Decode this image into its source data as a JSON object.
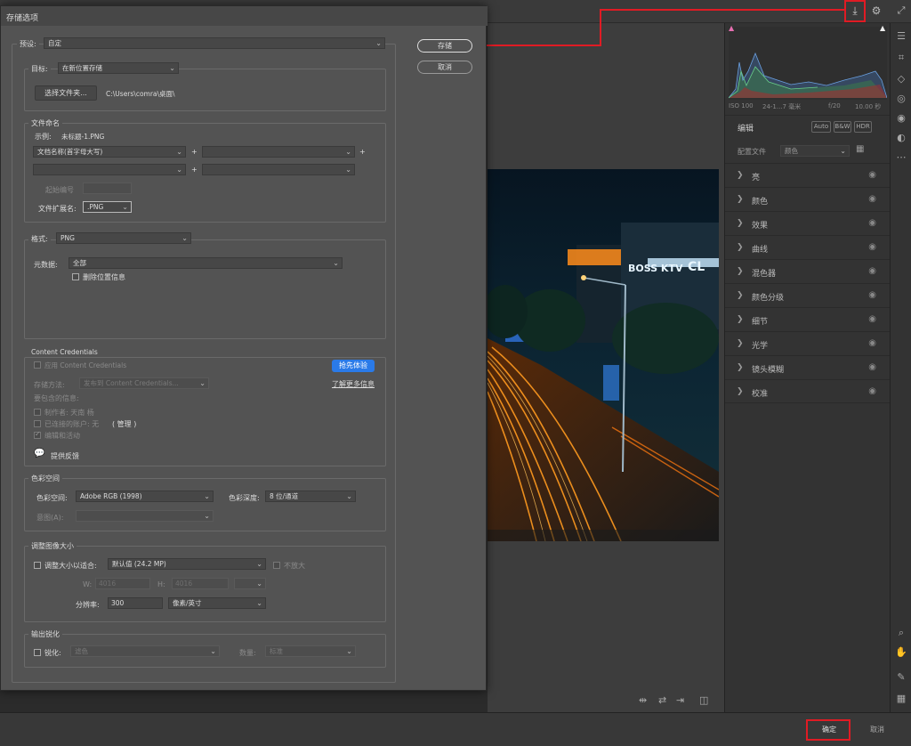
{
  "dialog": {
    "title": "存储选项",
    "preset_label": "预设:",
    "preset_value": "自定",
    "save_button": "存储",
    "cancel_button": "取消",
    "destination": {
      "label": "目标:",
      "value": "在新位置存储",
      "choose_folder_button": "选择文件夹...",
      "path": "C:\\Users\\comra\\桌面\\"
    },
    "file_naming": {
      "title": "文件命名",
      "example_label": "示例:",
      "example_value": "未标题-1.PNG",
      "name_field_1": "文档名称(首字母大写)",
      "plus": "+",
      "start_number_label": "起始编号",
      "extension_label": "文件扩展名:",
      "extension_value": ".PNG"
    },
    "format": {
      "label": "格式:",
      "value": "PNG",
      "metadata_label": "元数据:",
      "metadata_value": "全部",
      "remove_location_label": "删除位置信息"
    },
    "content_credentials": {
      "title": "Content Credentials",
      "apply_label": "应用 Content Credentials",
      "early_access_button": "抢先体验",
      "storage_label": "存储方法:",
      "storage_value": "发布到 Content Credentials...",
      "learn_more_link": "了解更多信息",
      "include_info_label": "要包含的信息:",
      "author_label": "制作者: 天南 杨",
      "connected_accounts_label": "已连接的账户: 无",
      "manage_label": "( 管理 )",
      "edits_activity_label": "编辑和活动",
      "feedback_label": "提供反馈"
    },
    "color_space": {
      "title": "色彩空间",
      "space_label": "色彩空间:",
      "space_value": "Adobe RGB (1998)",
      "depth_label": "色彩深度:",
      "depth_value": "8 位/通道",
      "intent_label": "意图(A):"
    },
    "resize": {
      "title": "调整图像大小",
      "fit_label": "调整大小以适合:",
      "fit_value": "默认值 (24.2 MP)",
      "no_enlarge_label": "不放大",
      "w_label": "W:",
      "w_value": "4016",
      "h_label": "H:",
      "h_value": "4016",
      "resolution_label": "分辨率:",
      "resolution_value": "300",
      "resolution_unit": "像素/英寸"
    },
    "sharpen": {
      "title": "输出锐化",
      "sharpen_label": "锐化:",
      "sharpen_value": "滤色",
      "amount_label": "数量:",
      "amount_value": "标准"
    }
  },
  "right_panel": {
    "camera_info": [
      "ISO 100",
      "24-1...7 毫米",
      "f/20",
      "10.00 秒"
    ],
    "edit_label": "编辑",
    "auto_button": "Auto",
    "bw_button": "B&W",
    "hdr_button": "HDR",
    "profile_label": "配置文件",
    "profile_value": "颜色",
    "sections": [
      "亮",
      "颜色",
      "效果",
      "曲线",
      "混色器",
      "颜色分级",
      "细节",
      "光学",
      "镜头模糊",
      "校准"
    ]
  },
  "bottom_bar": {
    "ok_button": "确定",
    "cancel_button": "取消"
  },
  "photo": {
    "sign_1": "BOSS KTV",
    "sign_2": "CL"
  }
}
